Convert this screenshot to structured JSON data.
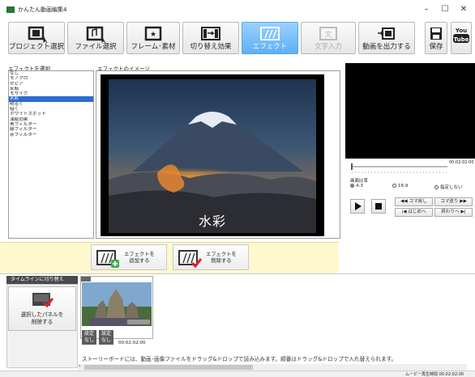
{
  "window": {
    "title": "かんたん動画編集4",
    "minimize": "–",
    "maximize": "☐",
    "close": "✕"
  },
  "toolbar": [
    {
      "label": "プロジェクト選択",
      "icon": "project-select-icon",
      "state": "normal"
    },
    {
      "label": "ファイル選択",
      "icon": "file-select-icon",
      "state": "normal"
    },
    {
      "label": "フレーム･素材",
      "icon": "frame-material-icon",
      "state": "normal"
    },
    {
      "label": "切り替え効果",
      "icon": "transition-icon",
      "state": "normal"
    },
    {
      "label": "エフェクト",
      "icon": "effect-icon",
      "state": "active"
    },
    {
      "label": "文字入力",
      "icon": "text-input-icon",
      "state": "disabled"
    },
    {
      "label": "動画を出力する",
      "icon": "export-video-icon",
      "state": "normal"
    },
    {
      "label": "保存",
      "icon": "save-icon",
      "state": "normal"
    },
    {
      "label": "公開",
      "icon": "youtube-icon",
      "state": "normal"
    }
  ],
  "youtube_text": [
    "You",
    "Tube"
  ],
  "effects": {
    "title": "エフェクトを選択",
    "items": [
      "なし",
      "モノクロ",
      "セピア",
      "反転",
      "モザイク",
      "水彩",
      "明るく",
      "暗く",
      "ホワイトスポット",
      "油絵効果",
      "青フィルター",
      "緑フィルター",
      "赤フィルター"
    ],
    "selected_index": 5
  },
  "preview": {
    "title": "エフェクトのイメージ",
    "overlay_text": "水彩"
  },
  "player": {
    "timecode": "00:02:02:00",
    "ratio_title": "画面比率",
    "ratios": [
      {
        "label": "4:3",
        "checked": true
      },
      {
        "label": "16:9",
        "checked": false
      },
      {
        "label": "指定しない",
        "checked": false
      }
    ],
    "buttons": {
      "prev_frame": "◀◀ コマ戻し",
      "next_frame": "コマ送り ▶▶",
      "to_start": "|◀ はじめへ",
      "to_end": "終わりへ ▶|"
    }
  },
  "actions": {
    "add_effect": [
      "エフェクトを",
      "追加する"
    ],
    "remove_effect": [
      "エフェクトを",
      "削除する"
    ]
  },
  "timeline": {
    "tab_label": "タイムラインに切り替え",
    "delete_panel": [
      "選択したパネルを",
      "削除する"
    ],
    "clip": {
      "duration": "00:02:02:00",
      "setting1": [
        "設定",
        "なし"
      ],
      "setting2": [
        "設定",
        "なし"
      ]
    },
    "message": "ストーリーボードには、動画･画像ファイルをドラッグ&ドロップで読み込みます。順番はドラッグ&ドロップで入れ替えられます。"
  },
  "status": {
    "text": "ムービー再生時間 00:02:02:00"
  },
  "colors": {
    "accent": "#5eb0f5",
    "selection": "#2c6bd2",
    "yellow_panel": "#fff8cf"
  }
}
